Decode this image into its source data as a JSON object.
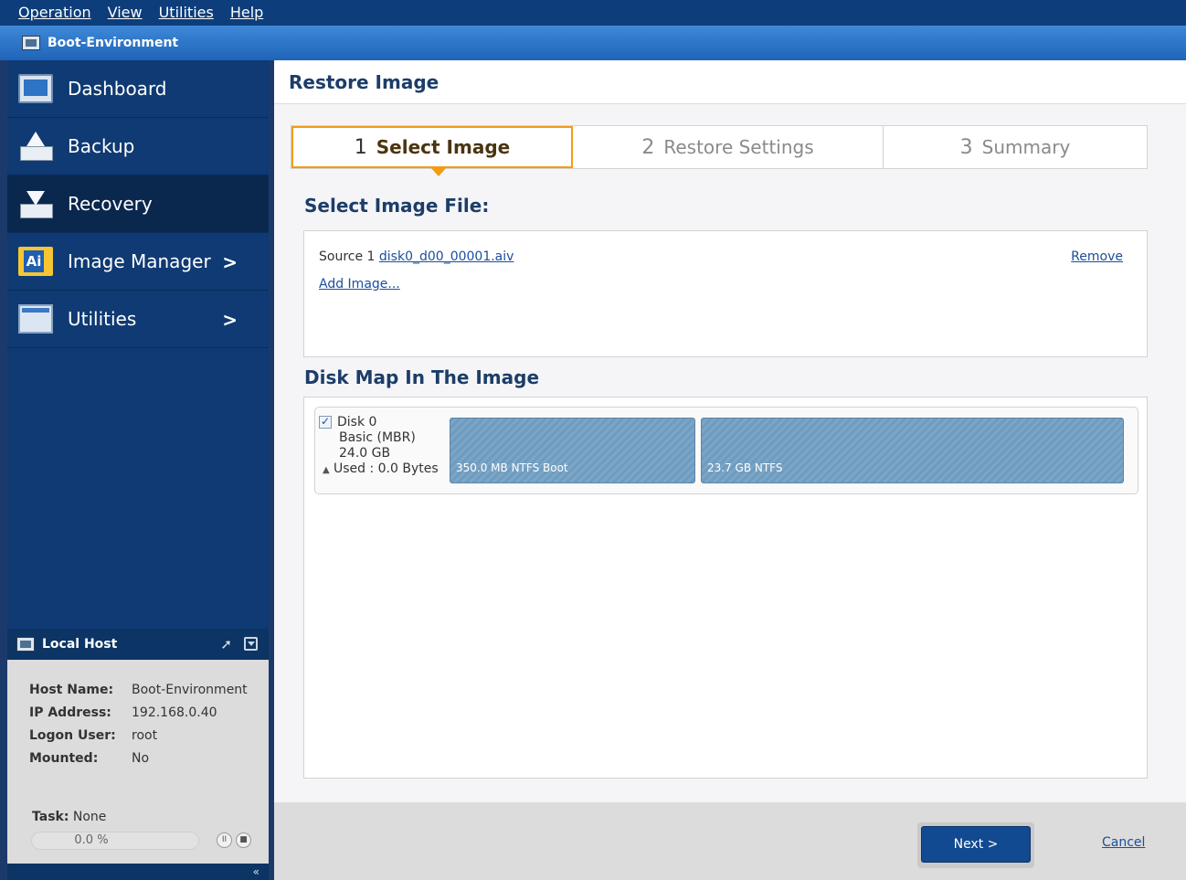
{
  "menubar": {
    "items": [
      "Operation",
      "View",
      "Utilities",
      "Help"
    ]
  },
  "titlebar": {
    "title": "Boot-Environment"
  },
  "sidebar": {
    "nav": [
      {
        "label": "Dashboard"
      },
      {
        "label": "Backup"
      },
      {
        "label": "Recovery"
      },
      {
        "label": "Image Manager"
      },
      {
        "label": "Utilities"
      }
    ],
    "local_host": {
      "title": "Local Host",
      "rows": [
        {
          "key": "Host Name:",
          "value": "Boot-Environment"
        },
        {
          "key": "IP Address:",
          "value": "192.168.0.40"
        },
        {
          "key": "Logon User:",
          "value": "root"
        },
        {
          "key": "Mounted:",
          "value": "No"
        }
      ],
      "task_label": "Task:",
      "task_value": "None",
      "progress_text": "0.0 %",
      "progress_fraction": 0.0
    },
    "collapse_glyph": "«"
  },
  "main": {
    "title": "Restore Image",
    "steps": [
      {
        "num": "1",
        "label": "Select Image"
      },
      {
        "num": "2",
        "label": "Restore Settings"
      },
      {
        "num": "3",
        "label": "Summary"
      }
    ],
    "select_file_title": "Select Image File:",
    "source_label": "Source 1",
    "source_file": "disk0_d00_00001.aiv",
    "add_image": "Add Image...",
    "remove": "Remove",
    "disk_map_title": "Disk Map In The Image",
    "disk": {
      "name": "Disk 0",
      "type": "Basic (MBR)",
      "size": "24.0 GB",
      "used": "Used : 0.0 Bytes",
      "partitions": [
        {
          "label": "350.0 MB NTFS Boot"
        },
        {
          "label": "23.7 GB NTFS"
        }
      ]
    },
    "buttons": {
      "next": "Next >",
      "cancel": "Cancel"
    }
  },
  "colors": {
    "accent": "#f39c12",
    "sidebar": "#0f3a73",
    "titlebar": "#1f64b8",
    "partition": "#6f9bbe"
  }
}
